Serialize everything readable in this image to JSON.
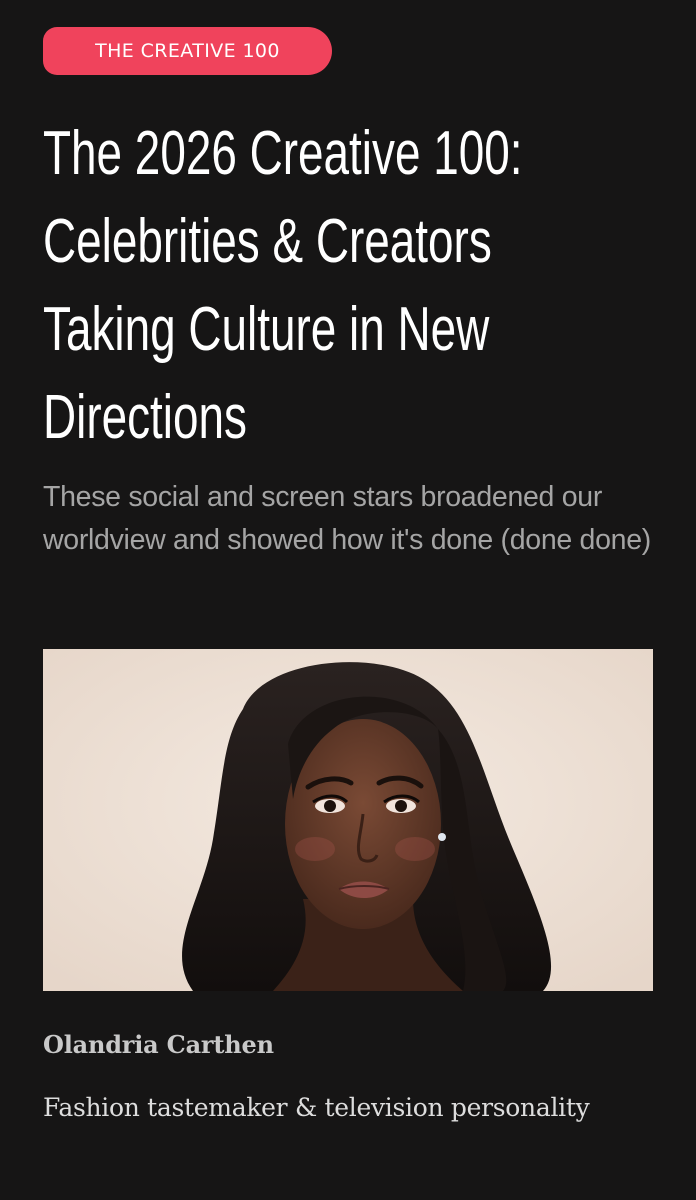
{
  "article": {
    "category_tag": "THE CREATIVE 100",
    "headline_lines": [
      "The 2026 Creative 100:",
      "Celebrities & Creators",
      "Taking Culture in New",
      "Directions"
    ],
    "subhead": "These social and screen stars broadened our worldview and showed how it's done (done done)"
  },
  "feature": {
    "name": "Olandria Carthen",
    "description": "Fashion tastemaker & television personality"
  },
  "colors": {
    "background": "#161515",
    "tag_background": "#f0435c",
    "headline": "#ffffff",
    "subhead": "#a5a5a5",
    "photo_backdrop": "#efe3d9"
  }
}
